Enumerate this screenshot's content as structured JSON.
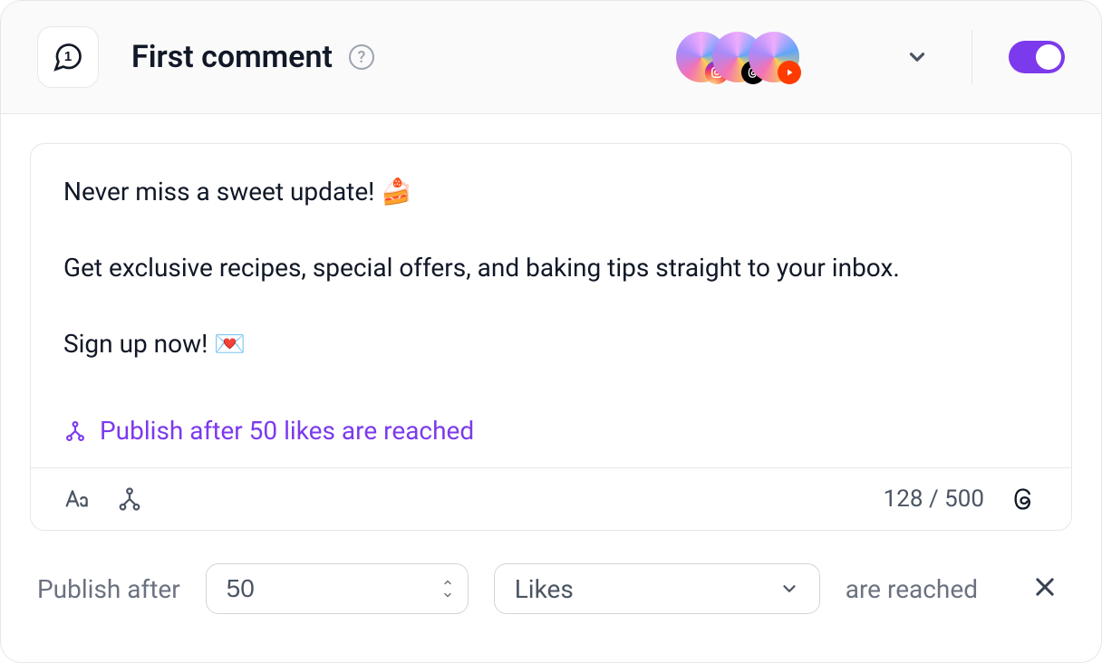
{
  "header": {
    "title": "First comment",
    "help_symbol": "?",
    "toggle_on": true
  },
  "accounts": [
    {
      "network": "instagram"
    },
    {
      "network": "threads"
    },
    {
      "network": "youtube"
    }
  ],
  "comment": {
    "line1": "Never miss a sweet update! 🍰",
    "line2": "Get exclusive recipes, special offers, and baking tips straight to your inbox.",
    "line3": "Sign up now! 💌"
  },
  "trigger_summary": "Publish after 50 likes are reached",
  "counter": {
    "used": 128,
    "limit": 500
  },
  "rule": {
    "prefix": "Publish after",
    "value": "50",
    "metric": "Likes",
    "suffix": "are reached"
  }
}
